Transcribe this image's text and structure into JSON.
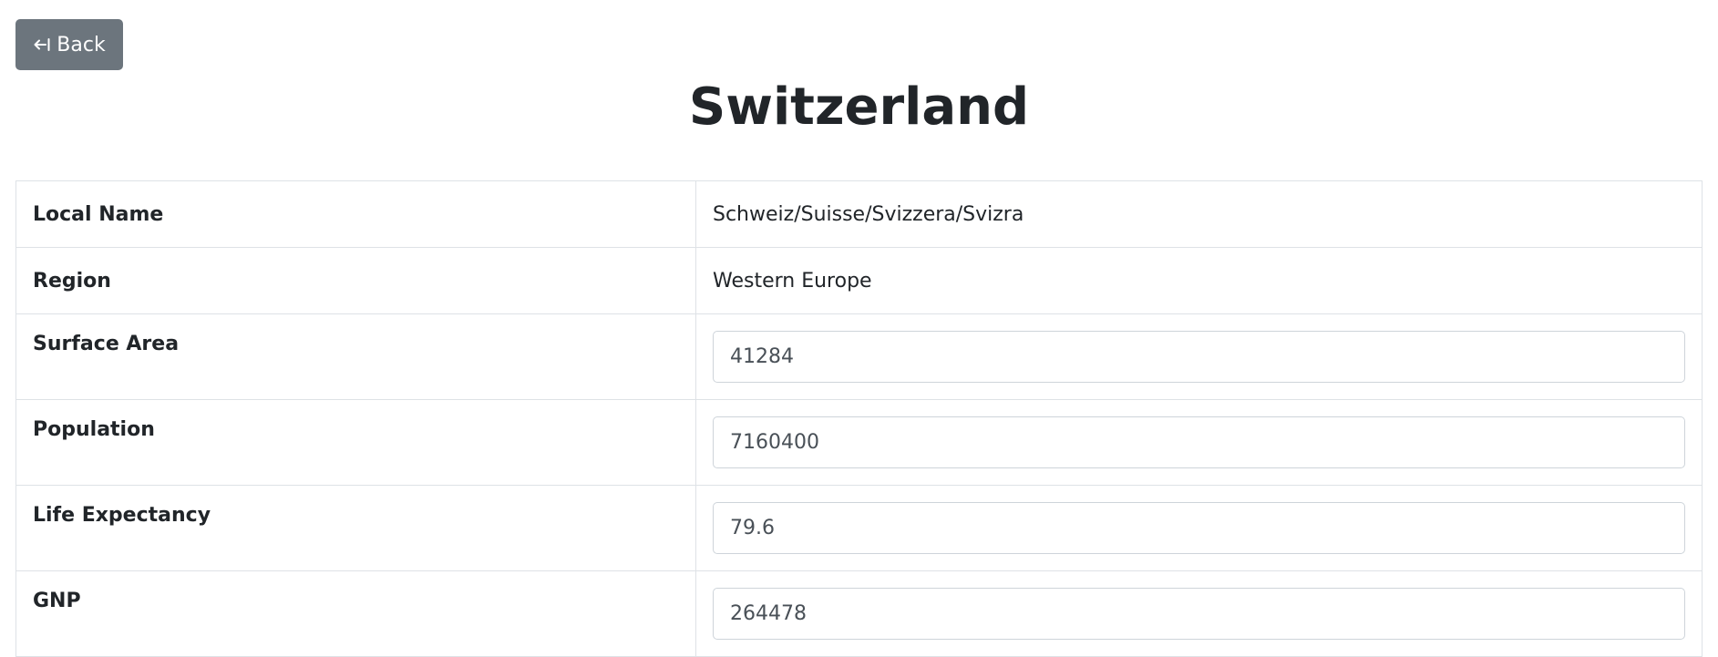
{
  "back_button": {
    "label": "Back",
    "icon": "arrow-left-bar-icon"
  },
  "title": "Switzerland",
  "details": {
    "local_name": {
      "label": "Local Name",
      "value": "Schweiz/Suisse/Svizzera/Svizra"
    },
    "region": {
      "label": "Region",
      "value": "Western Europe"
    },
    "surface_area": {
      "label": "Surface Area",
      "value": "41284"
    },
    "population": {
      "label": "Population",
      "value": "7160400"
    },
    "life_expectancy": {
      "label": "Life Expectancy",
      "value": "79.6"
    },
    "gnp": {
      "label": "GNP",
      "value": "264478"
    }
  },
  "colors": {
    "back_button_bg": "#6c757d",
    "border": "#dee2e6",
    "text": "#212529"
  }
}
